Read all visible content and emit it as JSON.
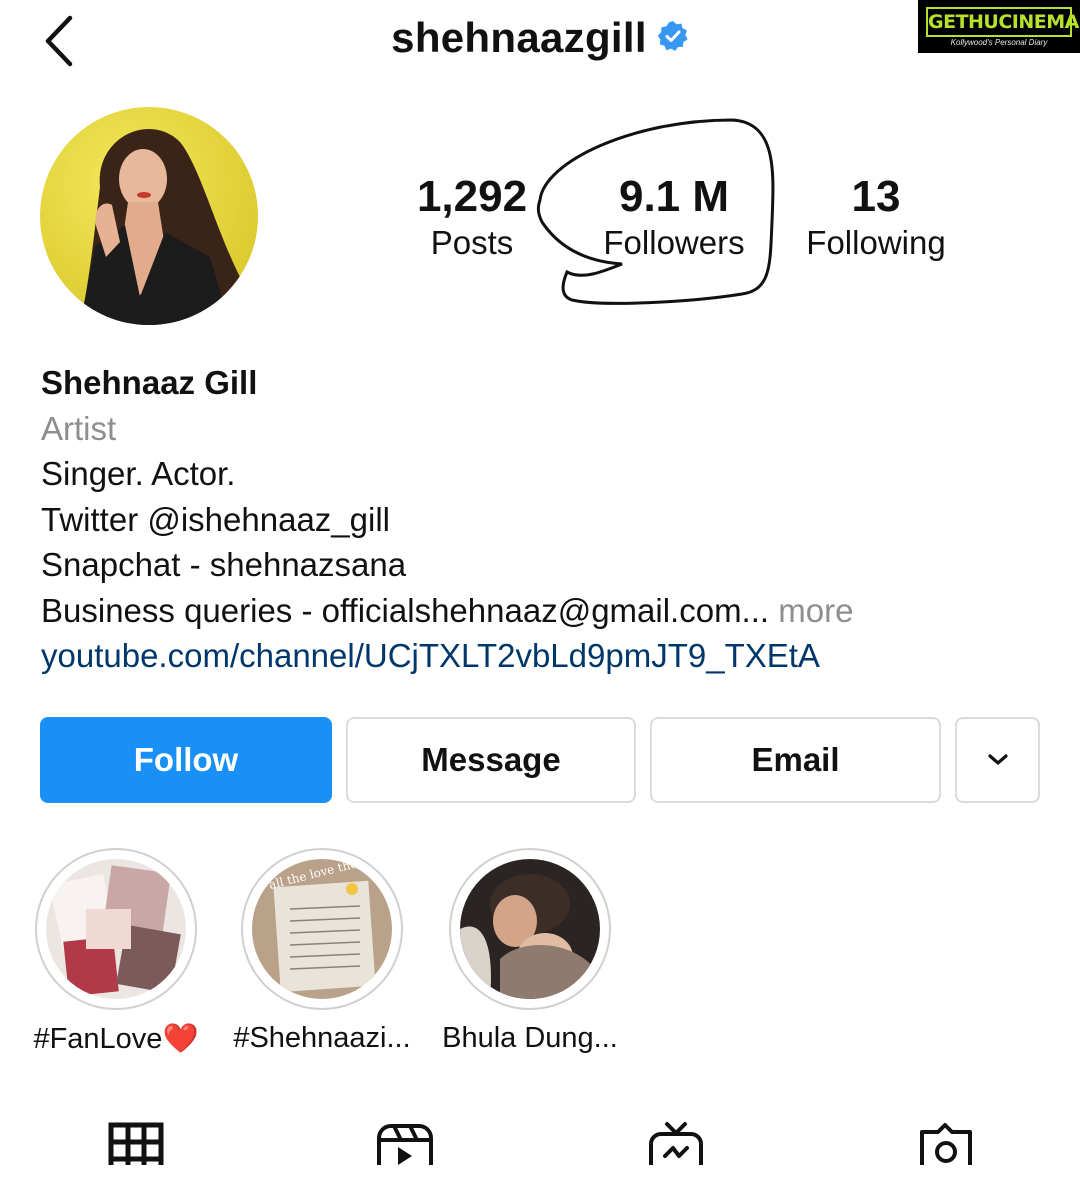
{
  "header": {
    "username": "shehnaazgill"
  },
  "watermark": {
    "brand": "GETHUCINEMA",
    "tagline": "Kollywood's Personal Diary"
  },
  "stats": {
    "posts_value": "1,292",
    "posts_label": "Posts",
    "followers_value": "9.1 M",
    "followers_label": "Followers",
    "following_value": "13",
    "following_label": "Following"
  },
  "bio": {
    "name": "Shehnaaz Gill",
    "category": "Artist",
    "lines": [
      "Singer. Actor.",
      "Twitter @ishehnaaz_gill",
      "Snapchat - shehnazsana",
      "Business queries - officialshehnaaz@gmail.com..."
    ],
    "more": "more",
    "link": "youtube.com/channel/UCjTXLT2vbLd9pmJT9_TXEtA"
  },
  "actions": {
    "follow": "Follow",
    "message": "Message",
    "email": "Email",
    "more_icon": "chevron-down-icon"
  },
  "highlights": [
    {
      "label": "#FanLove❤️"
    },
    {
      "label": "#Shehnaazi..."
    },
    {
      "label": "Bhula Dung..."
    }
  ],
  "highlight_photo_text": {
    "gift_caption": "all the love the gift"
  },
  "tabs": [
    {
      "icon": "grid-icon"
    },
    {
      "icon": "reels-icon"
    },
    {
      "icon": "igtv-icon"
    },
    {
      "icon": "tagged-icon"
    }
  ],
  "colors": {
    "follow_button": "#1890f5",
    "link": "#00376b",
    "muted_text": "#8e8e8e",
    "verified_badge": "#3897f0",
    "watermark_accent": "#b8e12c"
  }
}
